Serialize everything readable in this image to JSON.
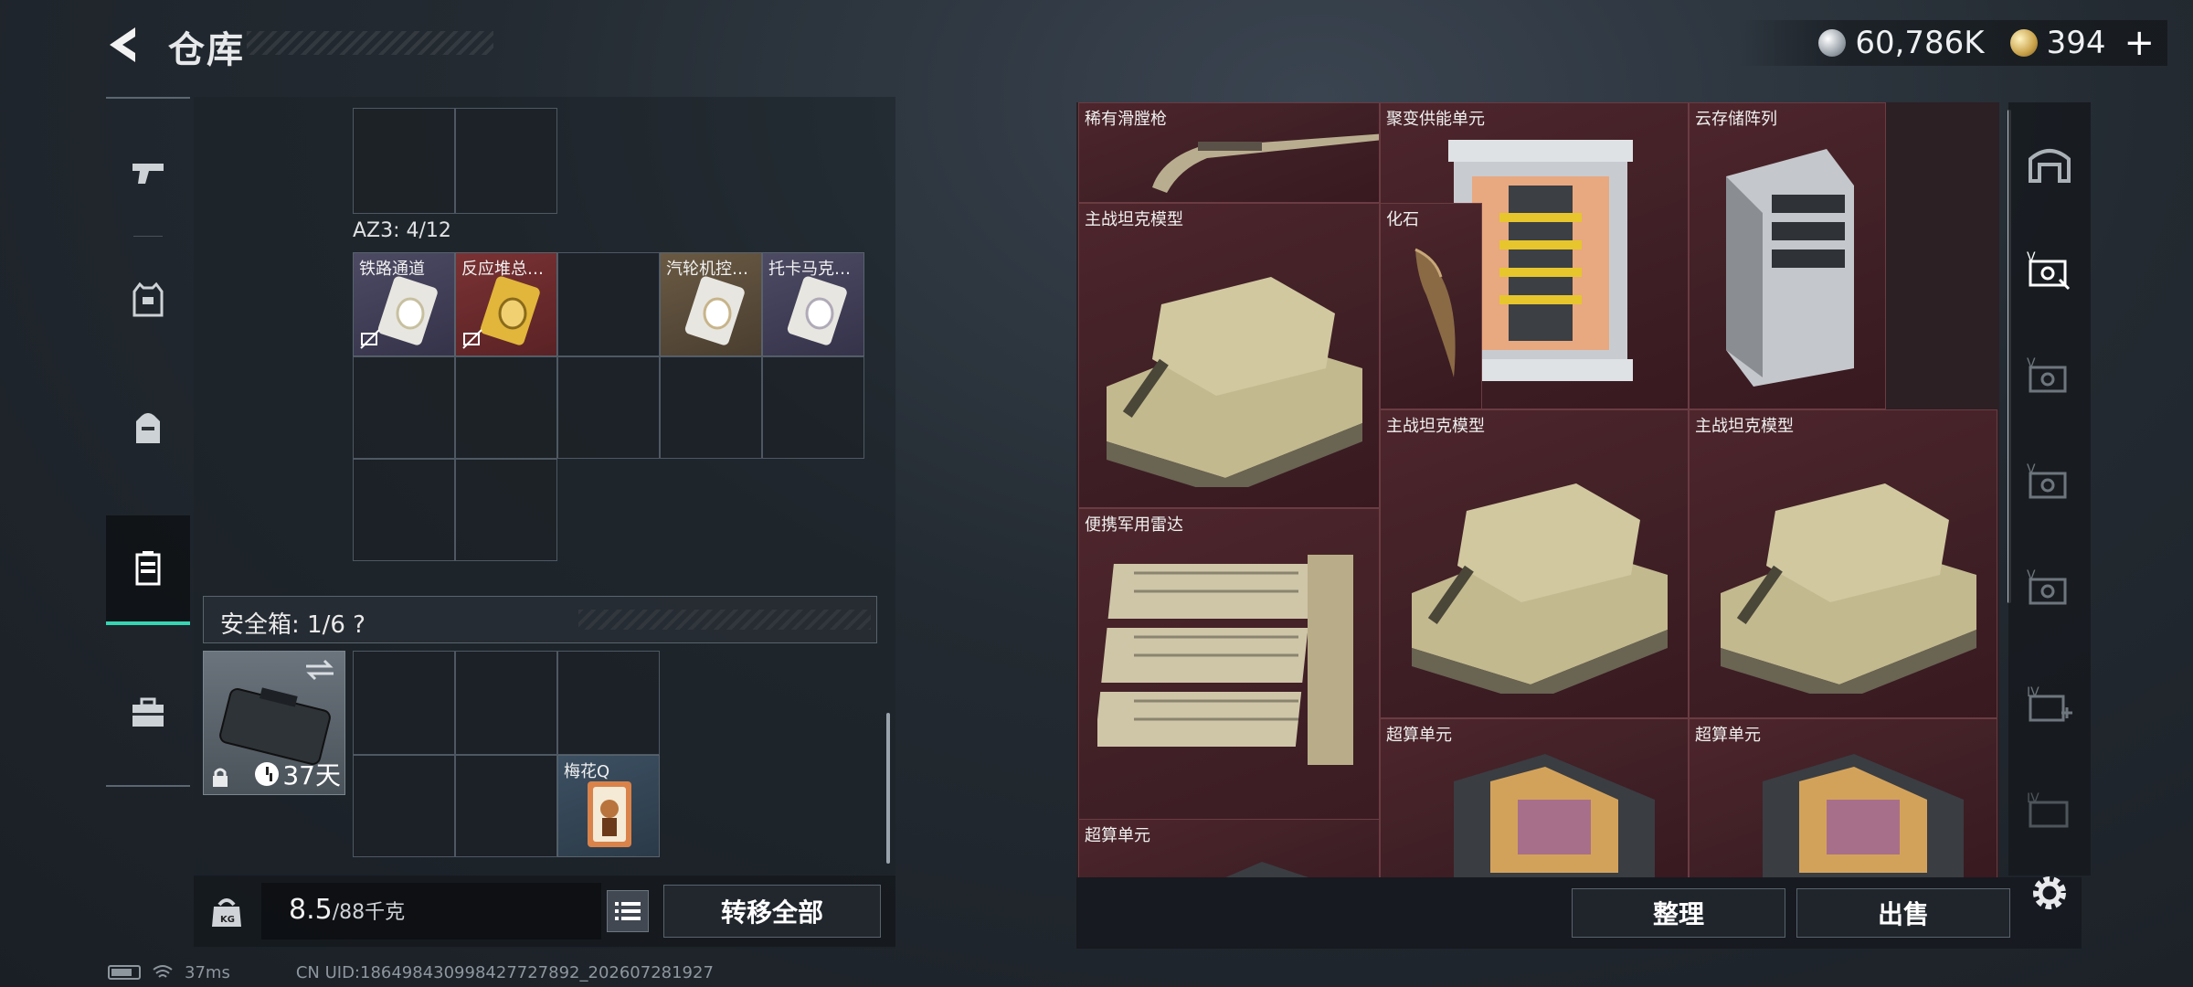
{
  "header": {
    "title": "仓库",
    "silver_amount": "60,786K",
    "gold_amount": "394",
    "add_label": "+"
  },
  "inventory": {
    "az3_label": "AZ3: 4/12",
    "items": [
      {
        "label": "铁路通道",
        "color": "#4b4860"
      },
      {
        "label": "反应堆总…",
        "color": "#6a2a2c"
      },
      {
        "label": "汽轮机控…",
        "color": "#5a4a3a"
      },
      {
        "label": "托卡马克…",
        "color": "#4b4860"
      }
    ],
    "safe_label": "安全箱: 1/6",
    "safe_help": "?",
    "safebox_days": "37天",
    "safe_item_label": "梅花Q",
    "weight_value": "8.5",
    "weight_max": "/88千克",
    "transfer_all": "转移全部"
  },
  "storage": {
    "items": [
      {
        "label": "稀有滑膛枪"
      },
      {
        "label": "聚变供能单元"
      },
      {
        "label": "云存储阵列"
      },
      {
        "label": "主战坦克模型"
      },
      {
        "label": "化石"
      },
      {
        "label": "主战坦克模型"
      },
      {
        "label": "主战坦克模型"
      },
      {
        "label": "便携军用雷达"
      },
      {
        "label": "超算单元"
      },
      {
        "label": "超算单元"
      },
      {
        "label": "超算单元"
      }
    ],
    "sort_label": "整理",
    "sell_label": "出售",
    "cell_color": "#3e1f25"
  },
  "status": {
    "ping": "37ms",
    "uid": "CN UID:18649843099842772789​2_202607281927"
  },
  "colors": {
    "accent": "#36d5b2"
  }
}
